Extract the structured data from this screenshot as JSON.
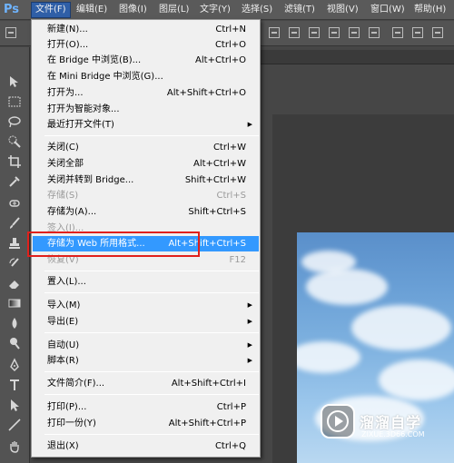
{
  "app": {
    "logo_text": "Ps"
  },
  "menubar": {
    "items": [
      {
        "label": "文件(F)"
      },
      {
        "label": "编辑(E)"
      },
      {
        "label": "图像(I)"
      },
      {
        "label": "图层(L)"
      },
      {
        "label": "文字(Y)"
      },
      {
        "label": "选择(S)"
      },
      {
        "label": "滤镜(T)"
      },
      {
        "label": "视图(V)"
      },
      {
        "label": "窗口(W)"
      },
      {
        "label": "帮助(H)"
      }
    ]
  },
  "file_menu": {
    "items": [
      {
        "label": "新建(N)...",
        "shortcut": "Ctrl+N"
      },
      {
        "label": "打开(O)...",
        "shortcut": "Ctrl+O"
      },
      {
        "label": "在 Bridge 中浏览(B)...",
        "shortcut": "Alt+Ctrl+O"
      },
      {
        "label": "在 Mini Bridge 中浏览(G)...",
        "shortcut": ""
      },
      {
        "label": "打开为...",
        "shortcut": "Alt+Shift+Ctrl+O"
      },
      {
        "label": "打开为智能对象...",
        "shortcut": ""
      },
      {
        "label": "最近打开文件(T)",
        "shortcut": ""
      },
      {
        "label": "关闭(C)",
        "shortcut": "Ctrl+W"
      },
      {
        "label": "关闭全部",
        "shortcut": "Alt+Ctrl+W"
      },
      {
        "label": "关闭并转到 Bridge...",
        "shortcut": "Shift+Ctrl+W"
      },
      {
        "label": "存储(S)",
        "shortcut": "Ctrl+S"
      },
      {
        "label": "存储为(A)...",
        "shortcut": "Shift+Ctrl+S"
      },
      {
        "label": "签入(I)...",
        "shortcut": ""
      },
      {
        "label": "存储为 Web 所用格式...",
        "shortcut": "Alt+Shift+Ctrl+S"
      },
      {
        "label": "恢复(V)",
        "shortcut": "F12"
      },
      {
        "label": "置入(L)...",
        "shortcut": ""
      },
      {
        "label": "导入(M)",
        "shortcut": ""
      },
      {
        "label": "导出(E)",
        "shortcut": ""
      },
      {
        "label": "自动(U)",
        "shortcut": ""
      },
      {
        "label": "脚本(R)",
        "shortcut": ""
      },
      {
        "label": "文件简介(F)...",
        "shortcut": "Alt+Shift+Ctrl+I"
      },
      {
        "label": "打印(P)...",
        "shortcut": "Ctrl+P"
      },
      {
        "label": "打印一份(Y)",
        "shortcut": "Alt+Shift+Ctrl+P"
      },
      {
        "label": "退出(X)",
        "shortcut": "Ctrl+Q"
      }
    ],
    "submenu_arrow": "▶"
  },
  "watermark": {
    "title": "溜溜自学",
    "url": "ZIXUE.3D66.COM"
  },
  "colors": {
    "menu_highlight": "#3399ff",
    "annotation_box": "#e0201c",
    "active_menu": "#2f5fa7"
  }
}
